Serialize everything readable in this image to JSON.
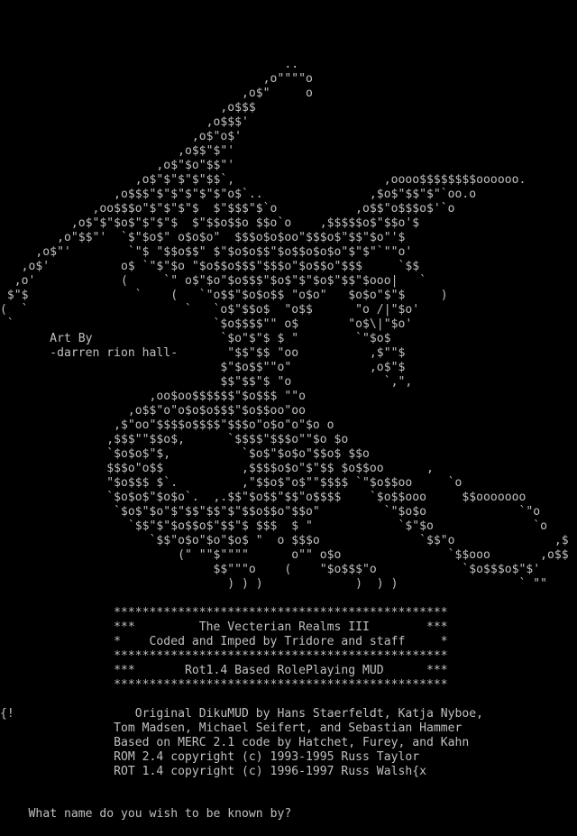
{
  "terminal": {
    "background": "#000000",
    "foreground": "#c0c0c0"
  },
  "screen": {
    "lines": [
      {
        "text": "                                        ..",
        "kind": "art"
      },
      {
        "text": "                                     ,o\"\"\"\"o",
        "kind": "art"
      },
      {
        "text": "                                  ,o$\"     o",
        "kind": "art"
      },
      {
        "text": "                               ,o$$$",
        "kind": "art"
      },
      {
        "text": "                             ,o$$$'",
        "kind": "art"
      },
      {
        "text": "                           ,o$\"o$'",
        "kind": "art"
      },
      {
        "text": "                         ,o$$\"$\"'",
        "kind": "art"
      },
      {
        "text": "                      ,o$\"$o\"$$\"'",
        "kind": "art"
      },
      {
        "text": "                   ,o$\"$\"$\"$\"$$`,                     ,oooo$$$$$$$$oooooo.",
        "kind": "art"
      },
      {
        "text": "                ,o$$$\"$\"$\"$\"$\"$\"o$`..               ,$o$\"$$\"$\"`oo.o",
        "kind": "art"
      },
      {
        "text": "             ,oo$$$o\"$\"$\"$\"$  $\"$$$\"$`o           ,o$$\"o$$$o$'`o",
        "kind": "art"
      },
      {
        "text": "          ,o$\"$\"$o$\"$\"$\"$  $\"$$o$$o $$o`o    ,$$$$$o$\"$$o'$",
        "kind": "art"
      },
      {
        "text": "        ,o\"$$\"'  `$\"$o$\" o$o$o\"  $$$o$o$oo\"$$$o$\"$$\"$o\"'$",
        "kind": "art"
      },
      {
        "text": "     ,o$\"'        `\"$ \"$$o$$\" $\"$o$o$$\"$o$$o$o$o\"$\"$\"`\"\"o'",
        "kind": "art"
      },
      {
        "text": "   ,o$'          o$ `\"$\"$o \"$o$$o$$$\"$$$o\"$o$$o\"$$$     `$$",
        "kind": "art"
      },
      {
        "text": "  ,o'            (     `\" o$\"$o\"$o$$$\"$o$\"$\"$o$\"$$\"$ooo|   `",
        "kind": "art"
      },
      {
        "text": " $\"$               `    (   `\"o$$\"$o$o$$ \"o$o\"   $o$o\"$\"$     )",
        "kind": "art"
      },
      {
        "text": "(  `                      `   `o$\"$$o$  \"o$$      \"o /|\"$o'",
        "kind": "art"
      },
      {
        "text": " `                            `$o$$$$\"\" o$       \"o$\\|\"$o'",
        "kind": "art"
      },
      {
        "text": "       Art By                  `$o\"$\"$ $ \"        `\"$o$",
        "kind": "credit"
      },
      {
        "text": "       -darren rion hall-       \"$$\"$$ \"oo          ,$\"\"$",
        "kind": "credit"
      },
      {
        "text": "                               $\"$o$$\"\"o\"           ,o$\"$",
        "kind": "art"
      },
      {
        "text": "                               $$\"$$\"$ \"o             `,\",",
        "kind": "art"
      },
      {
        "text": "                     ,oo$oo$$$$$$\"$o$$$ \"\"o",
        "kind": "art"
      },
      {
        "text": "                  ,o$$\"o\"o$o$o$$$\"$o$$oo\"oo",
        "kind": "art"
      },
      {
        "text": "                ,$\"oo\"$$$$o$$$$\"$$$o\"o$o\"o\"$o o",
        "kind": "art"
      },
      {
        "text": "               ,$$$\"\"$$o$,      `$$$$\"$$$o\"\"$o $o",
        "kind": "art"
      },
      {
        "text": "               `$o$o$\"$,          `$o$\"$o$o\"$$o$ $$o",
        "kind": "art"
      },
      {
        "text": "               $$$o\"o$$           ,$$$$o$o\"$\"$$ $o$$oo      ,",
        "kind": "art"
      },
      {
        "text": "               \"$o$$$ $`.         ,\"$$o$\"o$\"\"$$$$ `\"$o$$oo     `o",
        "kind": "art"
      },
      {
        "text": "               `$o$o$\"$o$o`.  ,.$$\"$o$$\"$$\"o$$$$    `$o$$ooo     $$ooooooo",
        "kind": "art"
      },
      {
        "text": "                `$o$\"$o\"$\"$$\"$$\"$\"$$o$$o\"$$o\"         `\"$o$o             `\"o",
        "kind": "art"
      },
      {
        "text": "                  `$$\"$\"$o$$o$\"$$\"$ $$$  $ \"            `$\"$o              `o",
        "kind": "art"
      },
      {
        "text": "                     `$$\"o$o\"$o\"$o$ \"  o $$$o              `$$\"o              ,$",
        "kind": "art"
      },
      {
        "text": "                         (\" \"\"$\"\"\"\"      o\"\" o$o               `$$ooo       ,o$$",
        "kind": "art"
      },
      {
        "text": "                              $$\"\"\"o    (    \"$o$$$\"o            `$o$$$o$\"$'",
        "kind": "art"
      },
      {
        "text": "                                ) ) )             )  ) )                 ` \"\"",
        "kind": "art"
      },
      {
        "text": "",
        "kind": "blank"
      },
      {
        "text": "                ***********************************************",
        "kind": "banner"
      },
      {
        "text": "                ***         The Vecterian Realms III        ***",
        "kind": "banner"
      },
      {
        "text": "                *    Coded and Imped by Tridore and staff     *",
        "kind": "banner"
      },
      {
        "text": "                ***********************************************",
        "kind": "banner"
      },
      {
        "text": "                ***       Rot1.4 Based RolePlaying MUD      ***",
        "kind": "banner"
      },
      {
        "text": "                ***********************************************",
        "kind": "banner"
      },
      {
        "text": "",
        "kind": "blank"
      },
      {
        "text": "{!                 Original DikuMUD by Hans Staerfeldt, Katja Nyboe,",
        "kind": "info"
      },
      {
        "text": "                Tom Madsen, Michael Seifert, and Sebastian Hammer",
        "kind": "info"
      },
      {
        "text": "                Based on MERC 2.1 code by Hatchet, Furey, and Kahn",
        "kind": "info"
      },
      {
        "text": "                ROM 2.4 copyright (c) 1993-1995 Russ Taylor",
        "kind": "info"
      },
      {
        "text": "                ROT 1.4 copyright (c) 1996-1997 Russ Walsh{x",
        "kind": "info"
      }
    ]
  },
  "prompt": {
    "text": "What name do you wish to be known by?"
  }
}
